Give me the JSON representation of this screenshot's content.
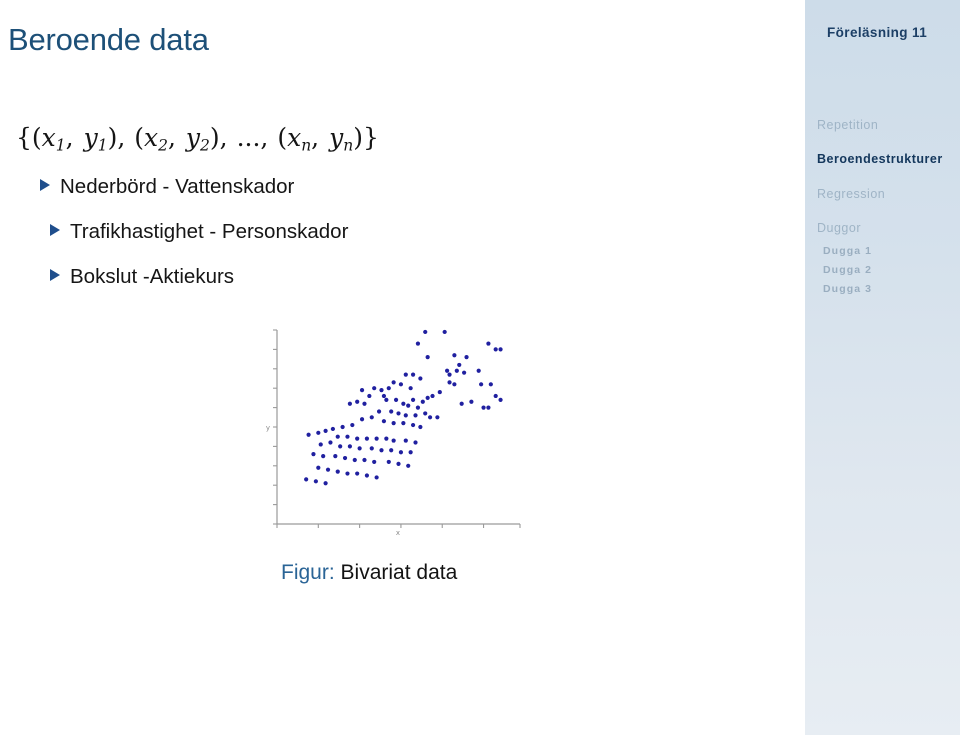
{
  "slide": {
    "title": "Beroende data",
    "math_set": {
      "open": "{",
      "pairs": [
        {
          "open": "(",
          "x": "x",
          "xsub": "1",
          "comma": ", ",
          "y": "y",
          "ysub": "1",
          "close": ")"
        },
        {
          "open": "(",
          "x": "x",
          "xsub": "2",
          "comma": ", ",
          "y": "y",
          "ysub": "2",
          "close": ")"
        },
        {
          "open": "(",
          "x": "x",
          "xsub": "n",
          "comma": ", ",
          "y": "y",
          "ysub": "n",
          "close": ")"
        }
      ],
      "ellipsis": "...",
      "separator": ",",
      "close": "}",
      "plain": "{(x1, y1), (x2, y2), ..., (xn, yn)}"
    },
    "bullets": [
      {
        "label": "Nederbörd - Vattenskador",
        "marker": "triangle-right-icon"
      },
      {
        "label": "Trafikhastighet - Personskador",
        "marker": "triangle-right-icon"
      },
      {
        "label": "Bokslut -Aktiekurs",
        "marker": "triangle-right-icon"
      }
    ],
    "figure": {
      "caption_label": "Figur:",
      "caption_text": "Bivariat data"
    }
  },
  "sidebar": {
    "lecture_title": "Föreläsning 11",
    "sections": [
      {
        "label": "Repetition",
        "active": false
      },
      {
        "label": "Beroendestrukturer",
        "active": true
      },
      {
        "label": "Regression",
        "active": false
      },
      {
        "label": "Duggor",
        "active": false
      }
    ],
    "subsections": [
      {
        "label": "Dugga 1"
      },
      {
        "label": "Dugga 2"
      },
      {
        "label": "Dugga 3"
      }
    ]
  },
  "colors": {
    "title_blue": "#1d5078",
    "bullet_marker_blue": "#1f4e8c",
    "sidebar_active": "#14375c",
    "sidebar_inactive": "#9fb4c6",
    "sidebar_bg_top": "#cddce9",
    "sidebar_bg_bottom": "#e7edf3",
    "scatter_point": "#2020a0",
    "axis_gray": "#9a9a9a",
    "caption_label_blue": "#2a6496"
  },
  "chart_data": {
    "type": "scatter",
    "title": "",
    "xlabel": "x",
    "ylabel": "y",
    "grid": false,
    "legend": null,
    "axis_style": "open L-shaped axes with tick marks, no tick labels",
    "xlim": [
      0,
      100
    ],
    "ylim": [
      0,
      100
    ],
    "x_ticks": [
      0,
      17,
      34,
      51,
      68,
      85,
      100
    ],
    "y_ticks": [
      0,
      10,
      20,
      30,
      40,
      50,
      60,
      70,
      80,
      90,
      100
    ],
    "series": [
      {
        "name": "Bivariat data",
        "color": "#2020a0",
        "marker": "circle",
        "n": 110,
        "points": [
          [
            61,
            99
          ],
          [
            69,
            99
          ],
          [
            87,
            93
          ],
          [
            90,
            90
          ],
          [
            92,
            90
          ],
          [
            58,
            93
          ],
          [
            73,
            87
          ],
          [
            78,
            86
          ],
          [
            75,
            82
          ],
          [
            62,
            86
          ],
          [
            74,
            79
          ],
          [
            70,
            79
          ],
          [
            71,
            77
          ],
          [
            77,
            78
          ],
          [
            83,
            79
          ],
          [
            71,
            73
          ],
          [
            73,
            72
          ],
          [
            84,
            72
          ],
          [
            88,
            72
          ],
          [
            53,
            77
          ],
          [
            56,
            77
          ],
          [
            59,
            75
          ],
          [
            48,
            73
          ],
          [
            51,
            72
          ],
          [
            46,
            70
          ],
          [
            55,
            70
          ],
          [
            67,
            68
          ],
          [
            64,
            66
          ],
          [
            62,
            65
          ],
          [
            90,
            66
          ],
          [
            92,
            64
          ],
          [
            80,
            63
          ],
          [
            76,
            62
          ],
          [
            85,
            60
          ],
          [
            87,
            60
          ],
          [
            40,
            70
          ],
          [
            35,
            69
          ],
          [
            43,
            69
          ],
          [
            38,
            66
          ],
          [
            44,
            66
          ],
          [
            45,
            64
          ],
          [
            49,
            64
          ],
          [
            56,
            64
          ],
          [
            60,
            63
          ],
          [
            33,
            63
          ],
          [
            36,
            62
          ],
          [
            30,
            62
          ],
          [
            52,
            62
          ],
          [
            54,
            61
          ],
          [
            58,
            60
          ],
          [
            42,
            58
          ],
          [
            47,
            58
          ],
          [
            50,
            57
          ],
          [
            53,
            56
          ],
          [
            57,
            56
          ],
          [
            61,
            57
          ],
          [
            63,
            55
          ],
          [
            66,
            55
          ],
          [
            39,
            55
          ],
          [
            35,
            54
          ],
          [
            44,
            53
          ],
          [
            48,
            52
          ],
          [
            52,
            52
          ],
          [
            56,
            51
          ],
          [
            59,
            50
          ],
          [
            31,
            51
          ],
          [
            27,
            50
          ],
          [
            23,
            49
          ],
          [
            20,
            48
          ],
          [
            17,
            47
          ],
          [
            13,
            46
          ],
          [
            25,
            45
          ],
          [
            29,
            45
          ],
          [
            33,
            44
          ],
          [
            37,
            44
          ],
          [
            41,
            44
          ],
          [
            45,
            44
          ],
          [
            48,
            43
          ],
          [
            53,
            43
          ],
          [
            57,
            42
          ],
          [
            22,
            42
          ],
          [
            18,
            41
          ],
          [
            26,
            40
          ],
          [
            30,
            40
          ],
          [
            34,
            39
          ],
          [
            39,
            39
          ],
          [
            43,
            38
          ],
          [
            47,
            38
          ],
          [
            51,
            37
          ],
          [
            55,
            37
          ],
          [
            15,
            36
          ],
          [
            19,
            35
          ],
          [
            24,
            35
          ],
          [
            28,
            34
          ],
          [
            32,
            33
          ],
          [
            36,
            33
          ],
          [
            40,
            32
          ],
          [
            46,
            32
          ],
          [
            50,
            31
          ],
          [
            54,
            30
          ],
          [
            17,
            29
          ],
          [
            21,
            28
          ],
          [
            25,
            27
          ],
          [
            29,
            26
          ],
          [
            33,
            26
          ],
          [
            37,
            25
          ],
          [
            41,
            24
          ],
          [
            12,
            23
          ],
          [
            16,
            22
          ],
          [
            20,
            21
          ]
        ]
      }
    ]
  }
}
